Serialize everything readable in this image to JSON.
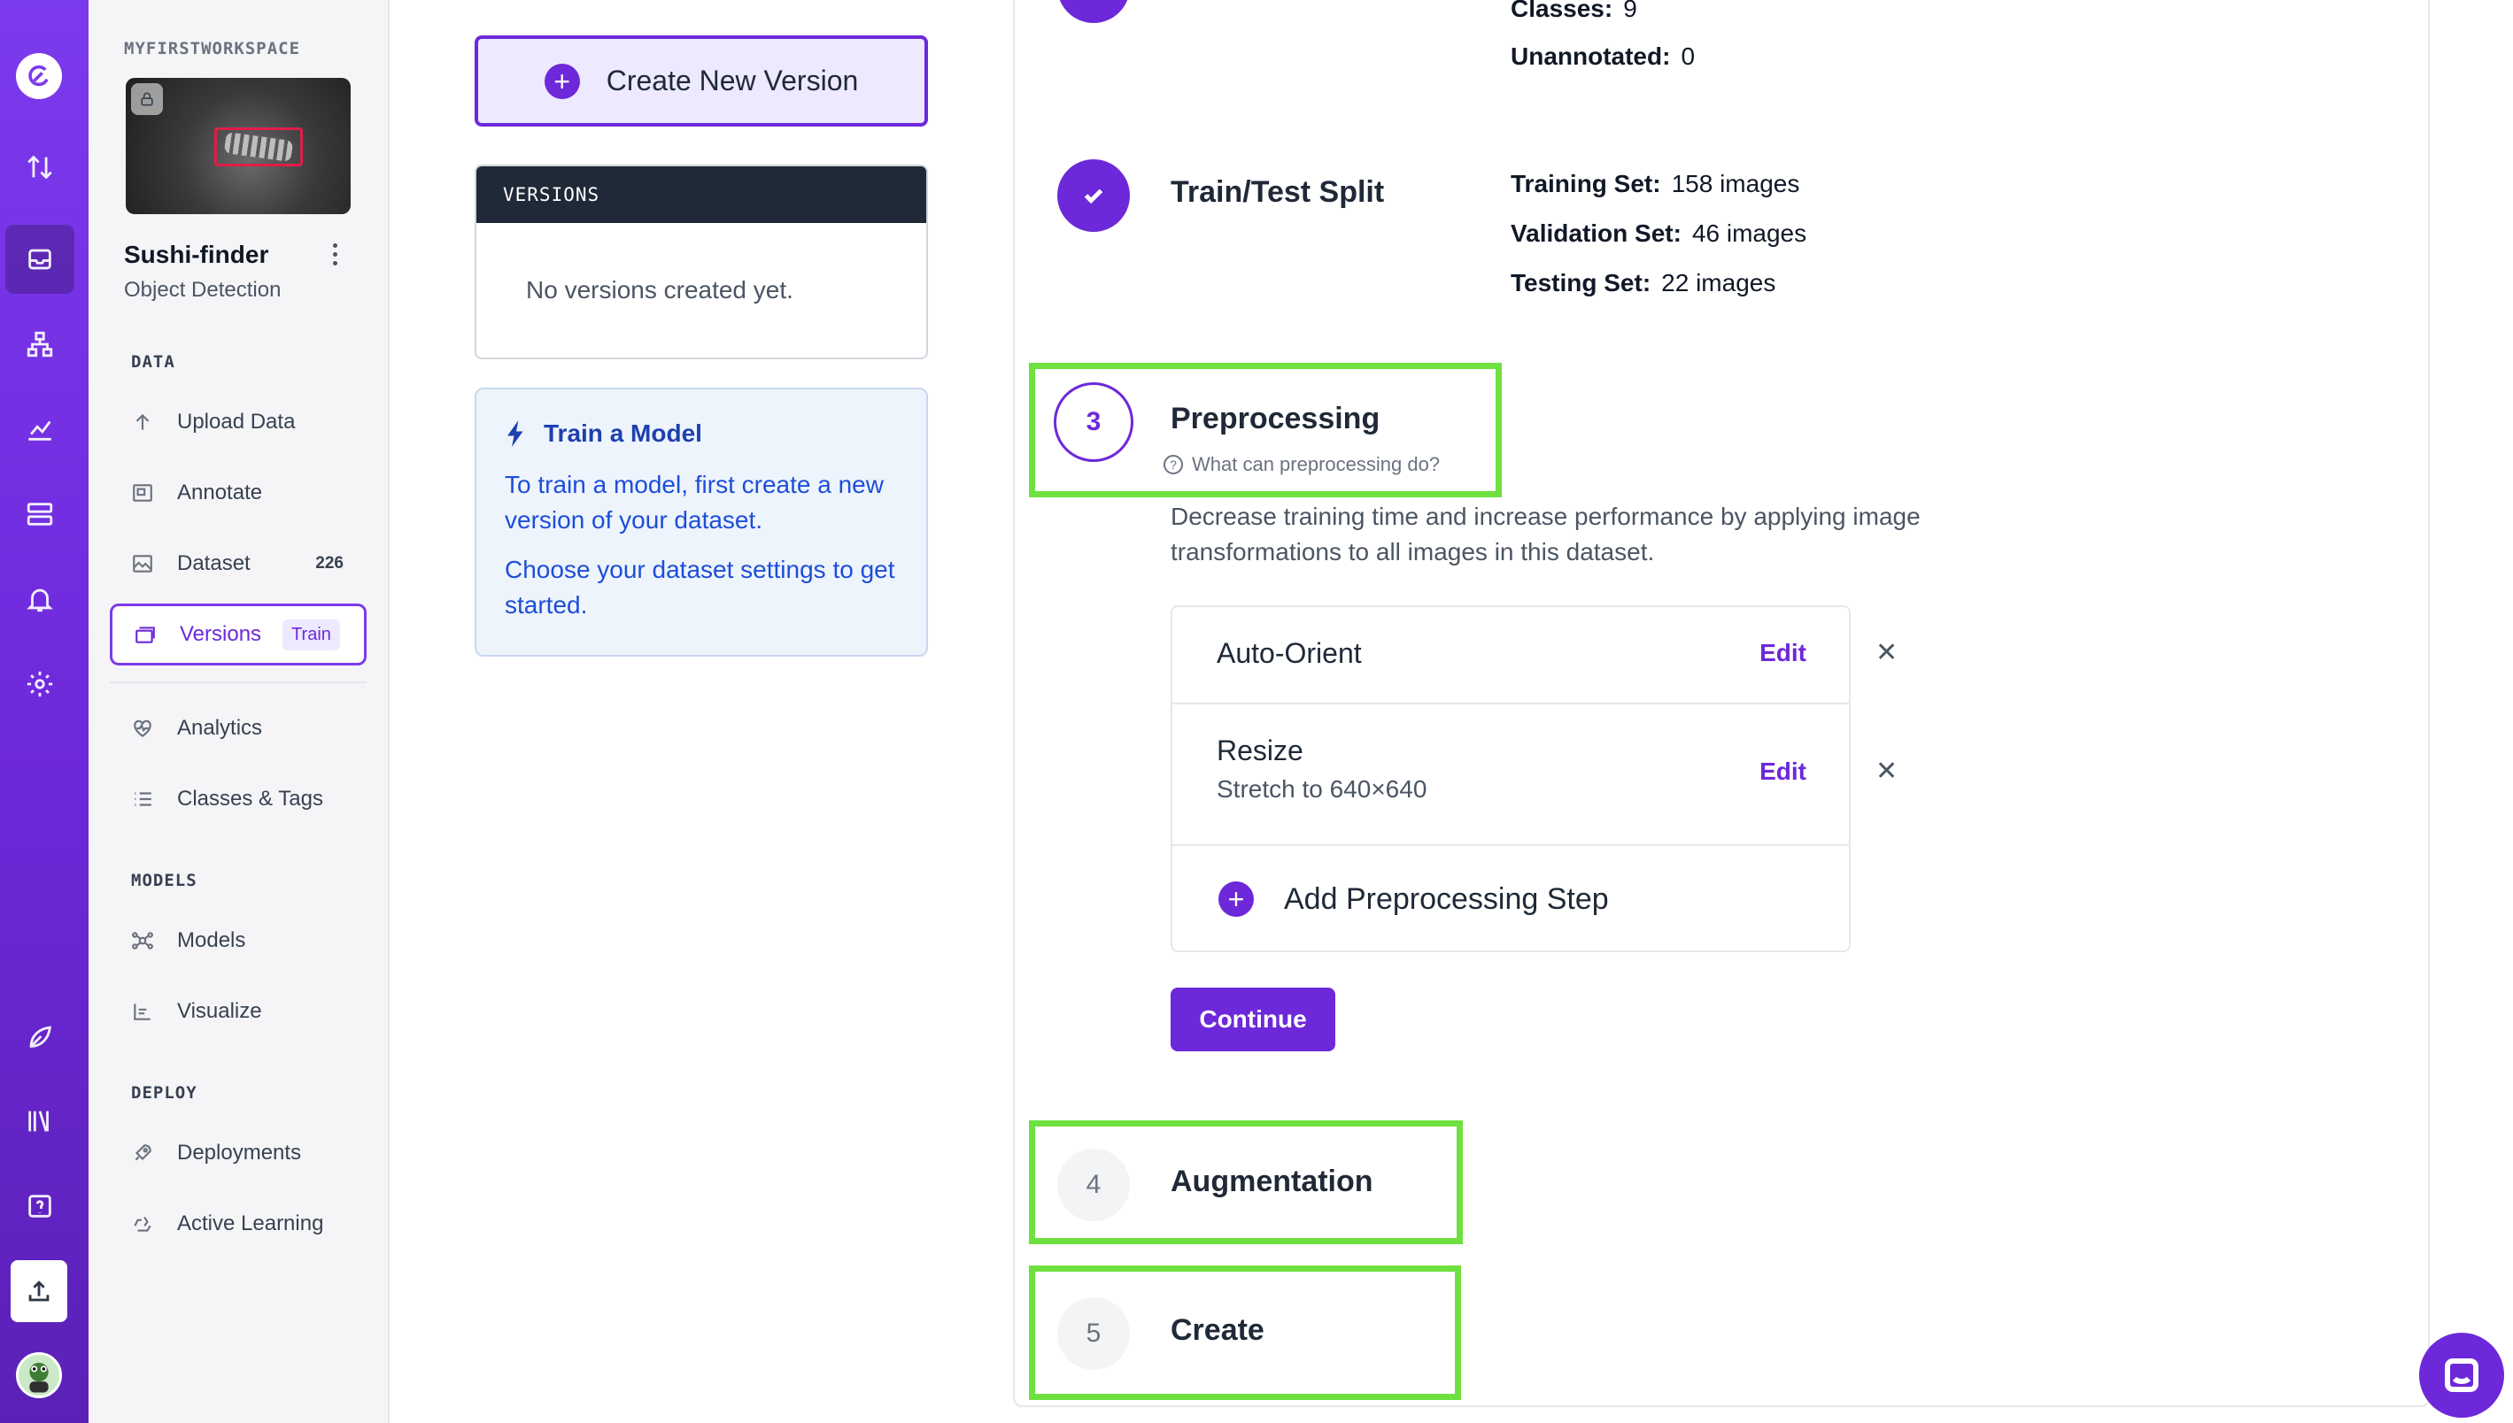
{
  "workspace": {
    "name": "MYFIRSTWORKSPACE"
  },
  "project": {
    "name": "Sushi-finder",
    "type": "Object Detection"
  },
  "rail": {
    "icons": [
      "logo-icon",
      "sort-icon",
      "inbox-icon",
      "hierarchy-icon",
      "analytics-icon",
      "server-icon",
      "bell-icon",
      "settings-icon",
      "plant-icon",
      "library-icon",
      "help-icon",
      "upload-icon",
      "user-avatar"
    ]
  },
  "sidebar": {
    "data_header": "DATA",
    "models_header": "MODELS",
    "deploy_header": "DEPLOY",
    "items": [
      {
        "label": "Upload Data"
      },
      {
        "label": "Annotate"
      },
      {
        "label": "Dataset",
        "badge": "226"
      },
      {
        "label": "Versions",
        "badge": "Train"
      },
      {
        "label": "Analytics"
      },
      {
        "label": "Classes & Tags"
      },
      {
        "label": "Models"
      },
      {
        "label": "Visualize"
      },
      {
        "label": "Deployments"
      },
      {
        "label": "Active Learning"
      }
    ]
  },
  "middle": {
    "create_label": "Create New Version",
    "versions_header": "VERSIONS",
    "versions_empty": "No versions created yet.",
    "train_title": "Train a Model",
    "train_p1": "To train a model, first create a new version of your dataset.",
    "train_p2": "Choose your dataset settings to get started."
  },
  "panel": {
    "top_stats": [
      {
        "label": "Classes:",
        "value": "9"
      },
      {
        "label": "Unannotated:",
        "value": "0"
      }
    ],
    "split": {
      "title": "Train/Test Split",
      "stats": [
        {
          "label": "Training Set:",
          "value": "158 images"
        },
        {
          "label": "Validation Set:",
          "value": "46 images"
        },
        {
          "label": "Testing Set:",
          "value": "22 images"
        }
      ]
    },
    "preprocessing": {
      "number": "3",
      "title": "Preprocessing",
      "help": "What can preprocessing do?",
      "description": "Decrease training time and increase performance by applying image transformations to all images in this dataset.",
      "steps": [
        {
          "name": "Auto-Orient",
          "detail": "",
          "edit": "Edit"
        },
        {
          "name": "Resize",
          "detail": "Stretch to 640×640",
          "edit": "Edit"
        }
      ],
      "add_label": "Add Preprocessing Step",
      "continue_label": "Continue"
    },
    "augmentation": {
      "number": "4",
      "title": "Augmentation"
    },
    "create": {
      "number": "5",
      "title": "Create"
    }
  },
  "colors": {
    "accent": "#6d28d9",
    "highlight": "#6ee040",
    "rail": "#7c3aed"
  }
}
